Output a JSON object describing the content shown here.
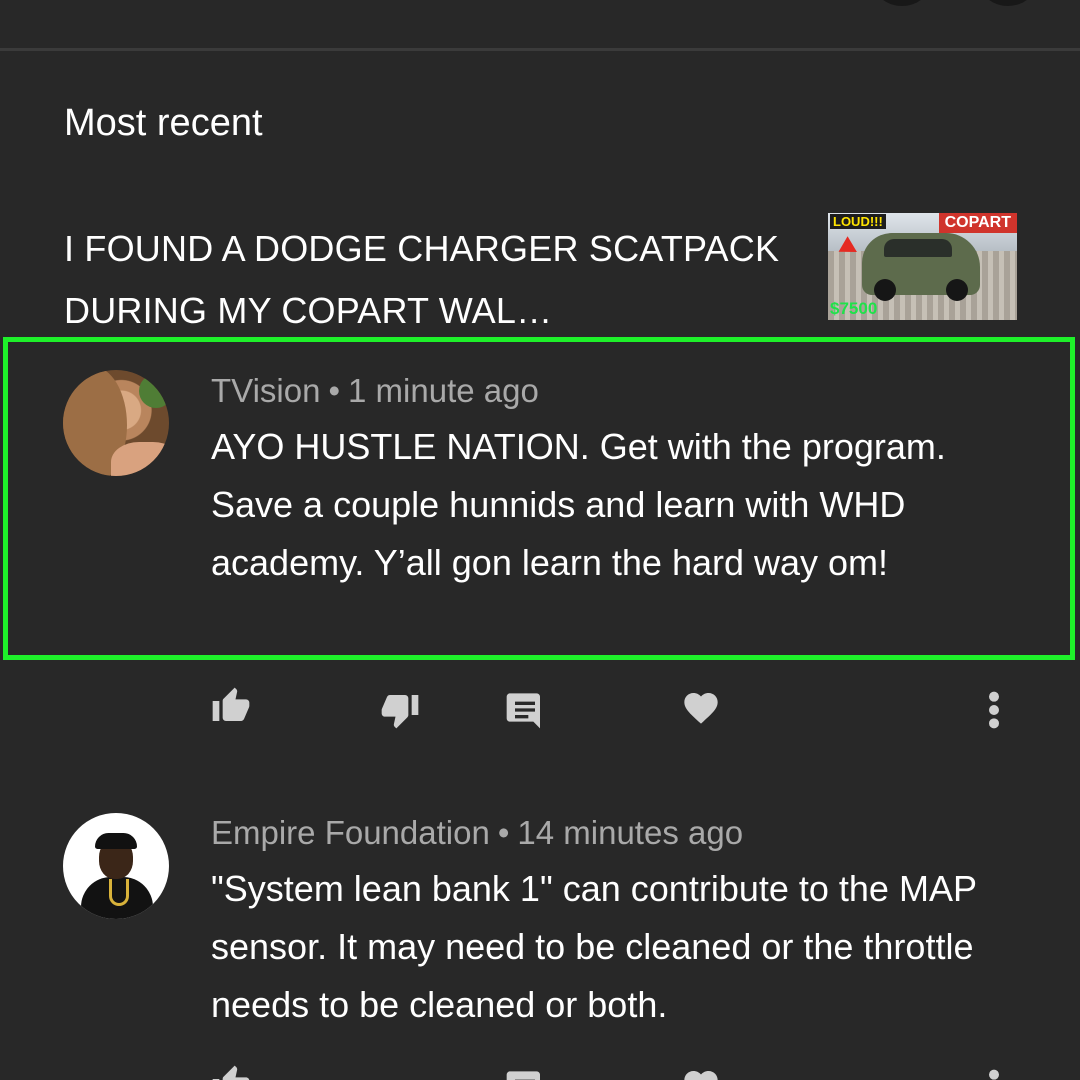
{
  "header": {
    "sort_label": "Most recent"
  },
  "video": {
    "title": "I FOUND A DODGE CHARGER SCATPACK DURING MY COPART WAL…",
    "thumbnail": {
      "badge_left": "LOUD!!!",
      "badge_right": "COPART",
      "price": "$7500"
    }
  },
  "comments": [
    {
      "author": "TVision",
      "separator": "•",
      "time": "1 minute ago",
      "text": "AYO HUSTLE NATION. Get with the program. Save a couple hunnids and learn with WHD academy. Y’all gon learn the hard way om!",
      "highlighted": true
    },
    {
      "author": "Empire Foundation",
      "separator": "•",
      "time": "14 minutes ago",
      "text": "\"System lean bank 1\" can contribute to the MAP sensor. It may need to be cleaned or the throttle needs to be cleaned or both.",
      "highlighted": false
    }
  ],
  "actions": {
    "icons": [
      "thumbs-up-icon",
      "thumbs-down-icon",
      "reply-icon",
      "heart-icon",
      "more-vert-icon"
    ]
  },
  "colors": {
    "background": "#282828",
    "highlight_border": "#1ef02a",
    "meta_text": "#a9a9a9",
    "icon": "#d0d0d0"
  }
}
